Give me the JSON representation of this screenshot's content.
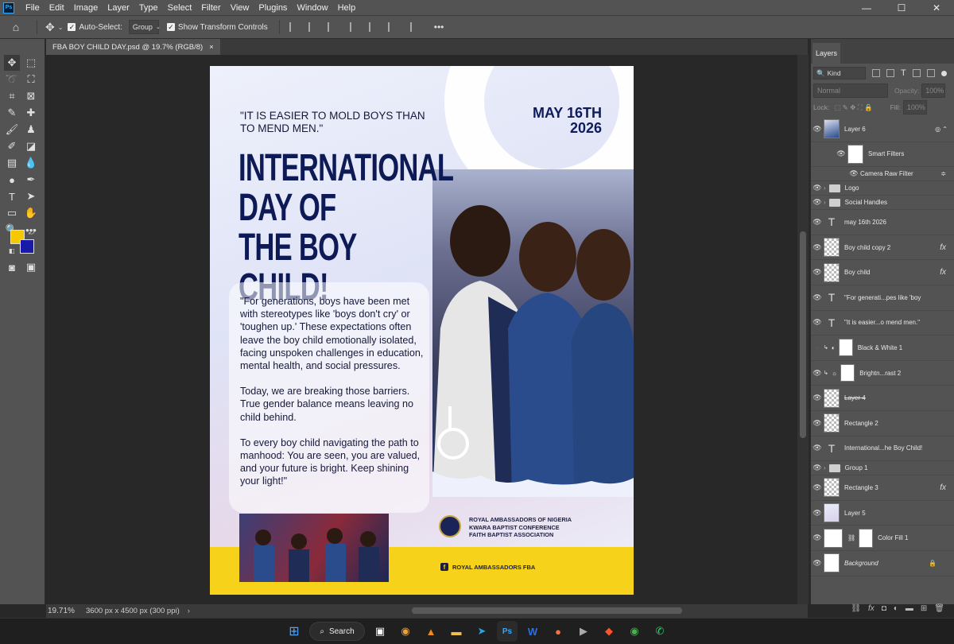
{
  "menubar": {
    "items": [
      "File",
      "Edit",
      "Image",
      "Layer",
      "Type",
      "Select",
      "Filter",
      "View",
      "Plugins",
      "Window",
      "Help"
    ],
    "app_logo": "Ps"
  },
  "window_controls": {
    "minimize": "—",
    "maximize": "☐",
    "close": "✕"
  },
  "options_bar": {
    "auto_select_label": "Auto-Select:",
    "auto_select_value": "Group",
    "show_transform_label": "Show Transform Controls"
  },
  "document": {
    "tab_title": "FBA BOY CHILD DAY.psd @ 19.7% (RGB/8)",
    "tab_close": "×",
    "zoom": "19.71%",
    "doc_info": "3600 px x 4500 px (300 ppi)"
  },
  "poster": {
    "quote_top": "\"IT IS EASIER TO MOLD BOYS THAN TO MEND MEN.\"",
    "date_line1": "MAY 16TH",
    "date_line2": "2026",
    "headline": "INTERNATIONAL\nDAY OF THE BOY\nCHILD!",
    "body_p1": "\"For generations, boys have been met with stereotypes like 'boys don't cry' or 'toughen up.' These expectations often leave the boy child emotionally isolated, facing unspoken challenges in education, mental health, and social pressures.",
    "body_p2": "Today, we are breaking those barriers. True gender balance means leaving no child behind.",
    "body_p3": "To every boy child navigating the path to manhood: You are seen, you are valued, and your future is bright. Keep shining your light!\"",
    "org_line1": "ROYAL AMBASSADORS OF NIGERIA",
    "org_line2": "KWARA BAPTIST CONFERENCE",
    "org_line3": "FAITH BAPTIST ASSOCIATION",
    "social_handle": "ROYAL AMBASSADORS FBA"
  },
  "layers_panel": {
    "tab_label": "Layers",
    "kind_filter": "Kind",
    "blend_mode": "Normal",
    "opacity_label": "Opacity:",
    "opacity_value": "100%",
    "lock_label": "Lock:",
    "fill_label": "Fill:",
    "fill_value": "100%",
    "layers": [
      {
        "name": "Layer 6",
        "type": "smart"
      },
      {
        "name": "Smart Filters",
        "type": "filtergroup"
      },
      {
        "name": "Camera Raw Filter",
        "type": "filter"
      },
      {
        "name": "Logo",
        "type": "folder"
      },
      {
        "name": "Social Handles",
        "type": "folder"
      },
      {
        "name": "may 16th 2026",
        "type": "text"
      },
      {
        "name": "Boy child copy 2",
        "type": "pixel",
        "fx": "fx"
      },
      {
        "name": "Boy child",
        "type": "pixel",
        "fx": "fx"
      },
      {
        "name": "\"For generati...pes like 'boy",
        "type": "text"
      },
      {
        "name": "\"It is easier...o mend men.\"",
        "type": "text"
      },
      {
        "name": "Black & White 1",
        "type": "adjust"
      },
      {
        "name": "Brightn...rast 2",
        "type": "adjust"
      },
      {
        "name": "Layer 4",
        "type": "pixel"
      },
      {
        "name": "Rectangle 2",
        "type": "pixel"
      },
      {
        "name": "International...he Boy Child!",
        "type": "text"
      },
      {
        "name": "Group 1",
        "type": "folder"
      },
      {
        "name": "Rectangle 3",
        "type": "pixel",
        "fx": "fx"
      },
      {
        "name": "Layer 5",
        "type": "pixel"
      },
      {
        "name": "Color Fill 1",
        "type": "fill"
      },
      {
        "name": "Background",
        "type": "background"
      }
    ]
  },
  "taskbar": {
    "search_label": "Search"
  },
  "colors": {
    "foreground": "#f5c800",
    "background": "#1a1aa8",
    "accent_yellow": "#f6d31a",
    "navy": "#0d1a55"
  }
}
